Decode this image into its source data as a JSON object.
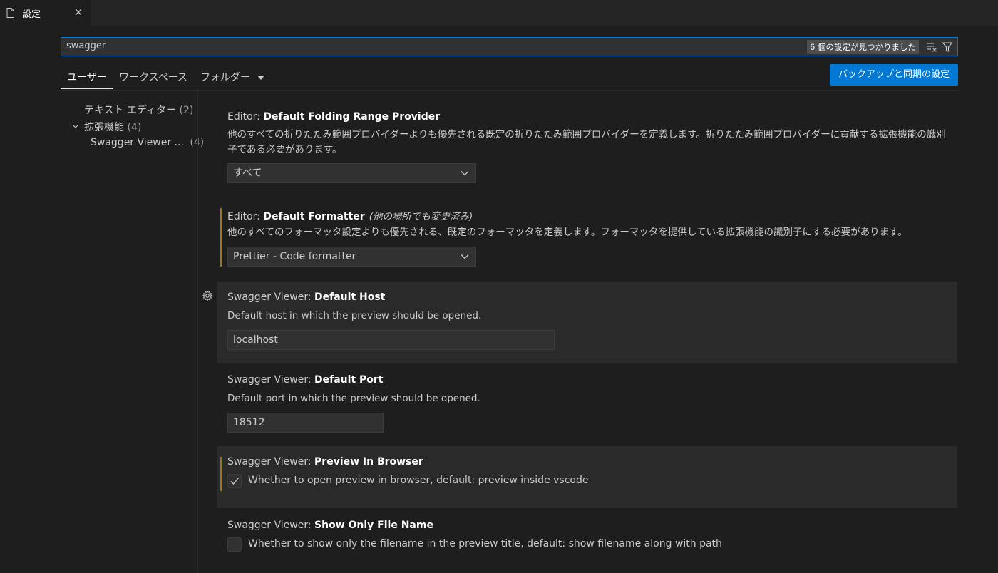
{
  "tab": {
    "title": "設定",
    "icon": "file-icon",
    "close_icon": "close-icon"
  },
  "search": {
    "value": "swagger",
    "result_count": "6 個の設定が見つかりました"
  },
  "scopes": {
    "user": "ユーザー",
    "workspace": "ワークスペース",
    "folder": "フォルダー"
  },
  "sync_button": "バックアップと同期の設定",
  "toc": {
    "text_editor": {
      "label": "テキスト エディター",
      "count": "(2)"
    },
    "extensions": {
      "label": "拡張機能",
      "count": "(4)"
    },
    "swagger_viewer": {
      "label": "Swagger Viewer ...",
      "count": "(4)"
    }
  },
  "settings": [
    {
      "category": "Editor: ",
      "name": "Default Folding Range Provider",
      "description": "他のすべての折りたたみ範囲プロバイダーよりも優先される既定の折りたたみ範囲プロバイダーを定義します。折りたたみ範囲プロバイダーに貢献する拡張機能の識別子である必要があります。",
      "value": "すべて"
    },
    {
      "category": "Editor: ",
      "name": "Default Formatter",
      "modified_note": "(他の場所でも変更済み)",
      "description": "他のすべてのフォーマッタ設定よりも優先される、既定のフォーマッタを定義します。フォーマッタを提供している拡張機能の識別子にする必要があります。",
      "value": "Prettier - Code formatter"
    },
    {
      "category": "Swagger Viewer: ",
      "name": "Default Host",
      "description": "Default host in which the preview should be opened.",
      "value": "localhost"
    },
    {
      "category": "Swagger Viewer: ",
      "name": "Default Port",
      "description": "Default port in which the preview should be opened.",
      "value": "18512"
    },
    {
      "category": "Swagger Viewer: ",
      "name": "Preview In Browser",
      "checkbox_label": "Whether to open preview in browser, default: preview inside vscode",
      "checked": true
    },
    {
      "category": "Swagger Viewer: ",
      "name": "Show Only File Name",
      "checkbox_label": "Whether to show only the filename in the preview title, default: show filename along with path",
      "checked": false
    }
  ],
  "colors": {
    "accent": "#0078d4",
    "modified": "#a0761d",
    "background": "#1e1e1e"
  }
}
